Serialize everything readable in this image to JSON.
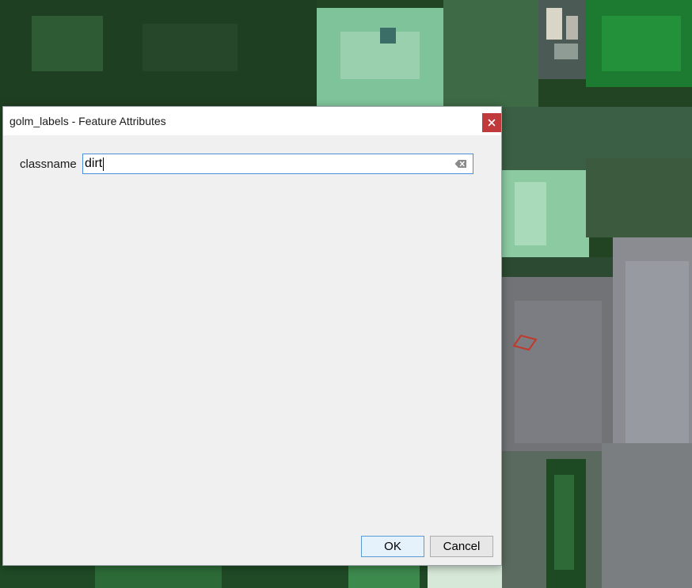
{
  "dialog": {
    "title": "golm_labels - Feature Attributes",
    "field_label": "classname",
    "field_value": "dirt",
    "ok_label": "OK",
    "cancel_label": "Cancel"
  },
  "icons": {
    "close": "close-icon",
    "clear": "backspace-clear-icon"
  },
  "colors": {
    "close_button": "#c0393b",
    "input_focus_border": "#4a90d9",
    "selected_feature_outline": "#c0392b"
  }
}
